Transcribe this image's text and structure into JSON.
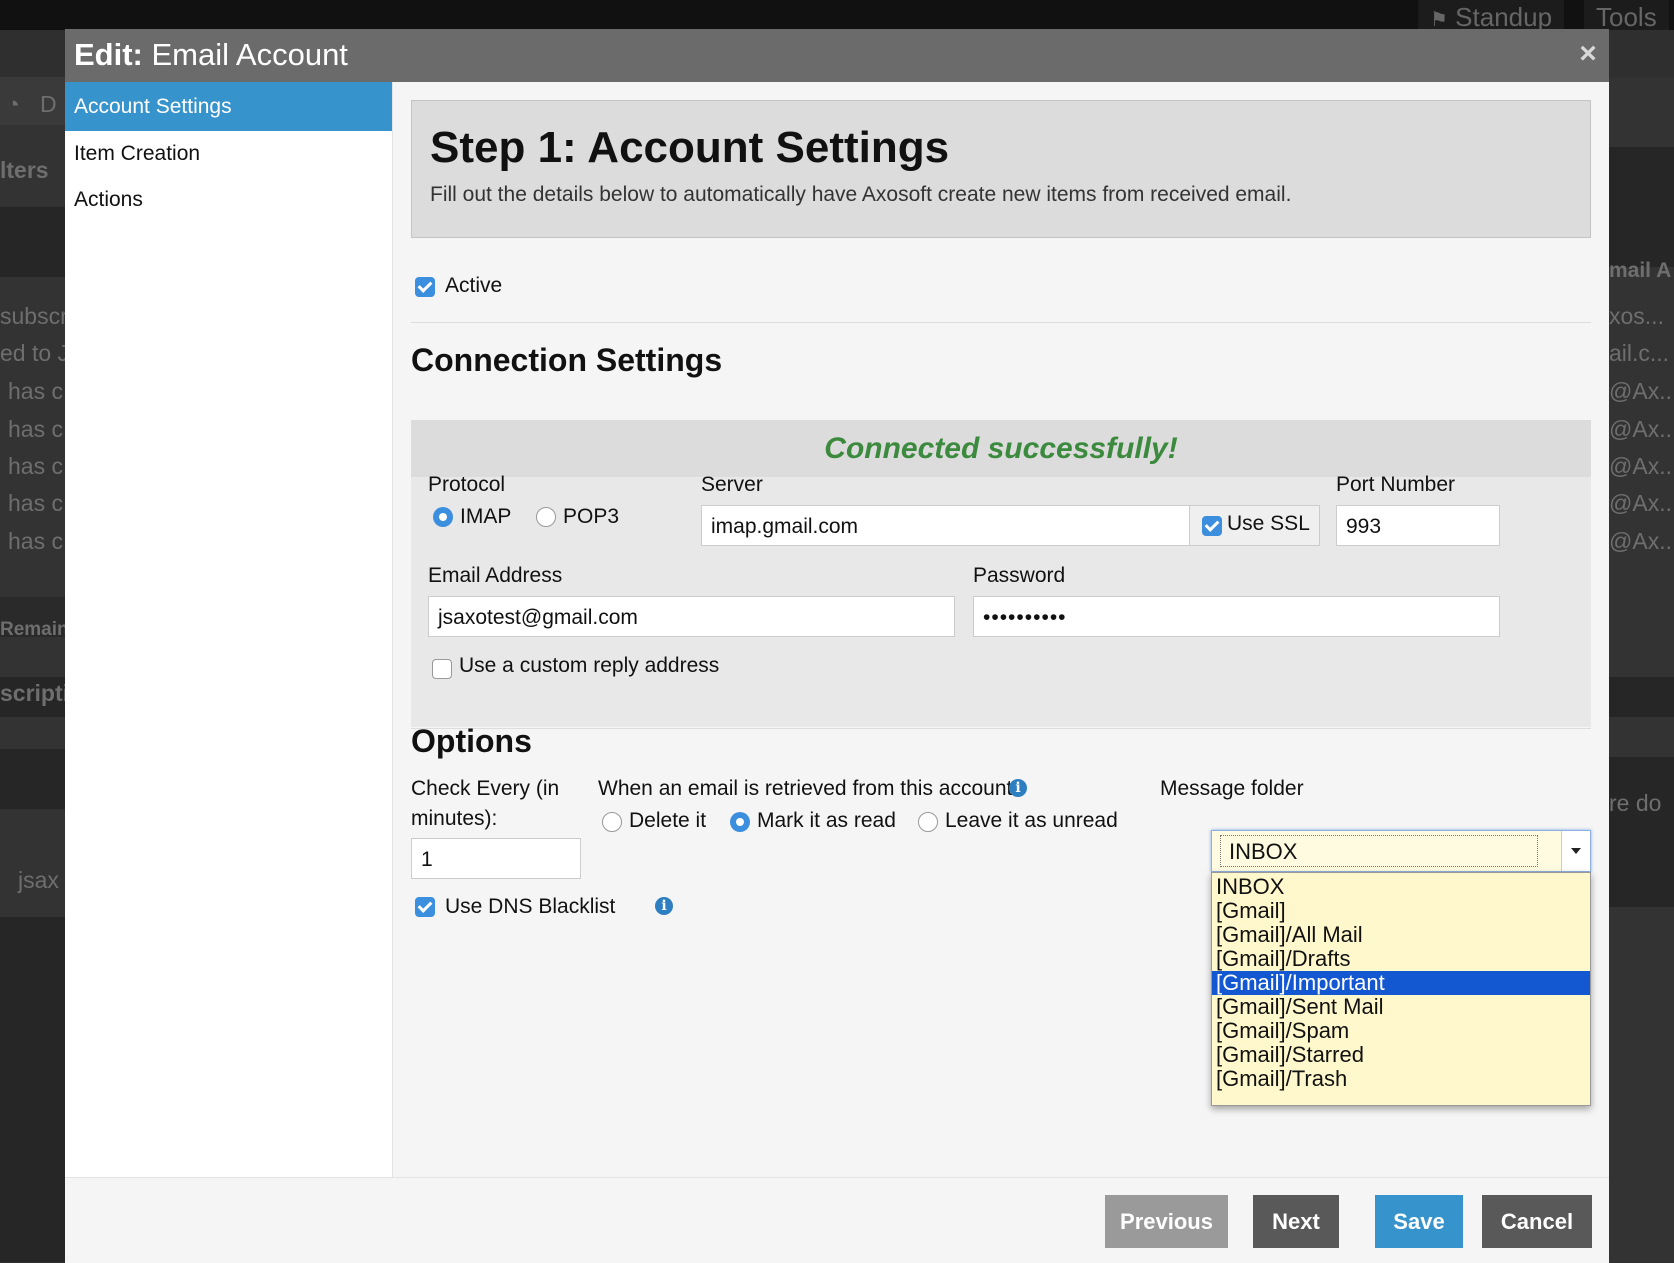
{
  "background_app": {
    "top_buttons": [
      "Standup",
      "Tools"
    ],
    "left_fragments": [
      "D",
      "lters",
      "subscr",
      "ed to J",
      "has c",
      "has c",
      "has c",
      "has c",
      "has c",
      "Remain",
      "scripti",
      "jsax"
    ],
    "right_fragments": [
      "mail A",
      "xos...",
      "ail.c...",
      "@Ax...",
      "@Ax...",
      "@Ax...",
      "@Ax...",
      "@Ax...",
      "re do"
    ]
  },
  "dialog": {
    "title_bold": "Edit:",
    "title_rest": " Email Account",
    "close_label": "×"
  },
  "sidebar": {
    "items": [
      {
        "label": "Account Settings",
        "active": true
      },
      {
        "label": "Item Creation",
        "active": false
      },
      {
        "label": "Actions",
        "active": false
      }
    ]
  },
  "step": {
    "title": "Step 1: Account Settings",
    "description": "Fill out the details below to automatically have Axosoft create new items from received email."
  },
  "active": {
    "label": "Active",
    "checked": true
  },
  "connection": {
    "heading": "Connection Settings",
    "status": "Connected successfully!",
    "status_color": "#3b8a3e",
    "protocol_label": "Protocol",
    "protocol_options": [
      {
        "label": "IMAP",
        "selected": true
      },
      {
        "label": "POP3",
        "selected": false
      }
    ],
    "server_label": "Server",
    "server_value": "imap.gmail.com",
    "use_ssl_label": "Use SSL",
    "use_ssl_checked": true,
    "port_label": "Port Number",
    "port_value": "993",
    "email_label": "Email Address",
    "email_value": "jsaxotest@gmail.com",
    "password_label": "Password",
    "password_value": "••••••••••",
    "custom_reply_label": "Use a custom reply address",
    "custom_reply_checked": false
  },
  "options": {
    "heading": "Options",
    "check_every_label_line1": "Check Every (in",
    "check_every_label_line2": "minutes):",
    "check_every_value": "1",
    "retrieved_label": "When an email is retrieved from this account",
    "retrieved_options": [
      {
        "label": "Delete it",
        "selected": false
      },
      {
        "label": "Mark it as read",
        "selected": true
      },
      {
        "label": "Leave it as unread",
        "selected": false
      }
    ],
    "message_folder_label": "Message folder",
    "message_folder_value": "INBOX",
    "folder_options": [
      "INBOX",
      "[Gmail]",
      "[Gmail]/All Mail",
      "[Gmail]/Drafts",
      "[Gmail]/Important",
      "[Gmail]/Sent Mail",
      "[Gmail]/Spam",
      "[Gmail]/Starred",
      "[Gmail]/Trash"
    ],
    "highlighted_folder": "[Gmail]/Important",
    "dns_blacklist_label": "Use DNS Blacklist",
    "dns_blacklist_checked": true
  },
  "footer": {
    "previous_label": "Previous",
    "next_label": "Next",
    "save_label": "Save",
    "cancel_label": "Cancel"
  },
  "colors": {
    "accent": "#3793cc",
    "header": "#6b6b6b",
    "checkbox": "#3c8fde",
    "dropdown_highlight": "#1357d1"
  }
}
